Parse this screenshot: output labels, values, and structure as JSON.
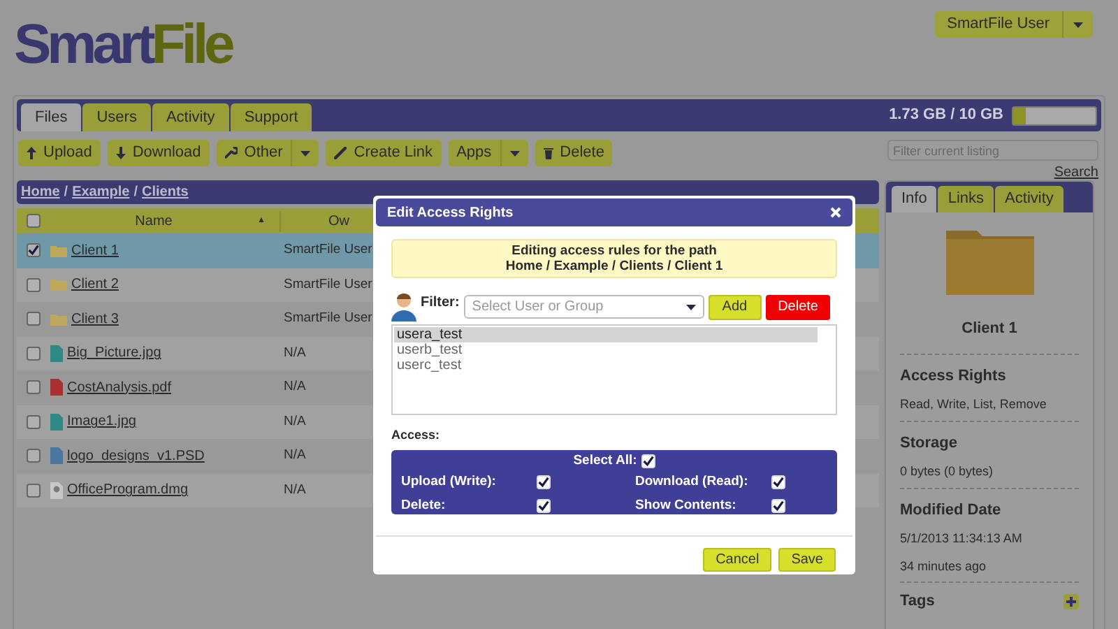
{
  "logo": [
    "Smart",
    "File"
  ],
  "user_menu": {
    "label": "SmartFile User"
  },
  "main_tabs": [
    {
      "label": "Files",
      "selected": true
    },
    {
      "label": "Users",
      "selected": false
    },
    {
      "label": "Activity",
      "selected": false
    },
    {
      "label": "Support",
      "selected": false
    }
  ],
  "storage": {
    "reading": "1.73 GB / 10 GB",
    "level": 0.16
  },
  "toolbar": [
    {
      "label": "Upload",
      "dropdown": false
    },
    {
      "label": "Download",
      "dropdown": false
    },
    {
      "label": "Other",
      "dropdown": true
    },
    {
      "label": "Create Link",
      "dropdown": false
    },
    {
      "label": "Apps",
      "dropdown": true
    },
    {
      "label": "Delete",
      "dropdown": false
    }
  ],
  "filter": {
    "placeholder": "Filter current listing"
  },
  "search_link": "Search",
  "breadcrumb": {
    "items": [
      "Home",
      "Example",
      "Clients"
    ],
    "separator": "/"
  },
  "table": {
    "columns": [
      "Name",
      "Ow"
    ],
    "sort_arrow": "▲",
    "all_checked": false,
    "rows": [
      {
        "name": "Client 1",
        "owner": "SmartFile User",
        "kind": "folder",
        "checked": true,
        "selected": true
      },
      {
        "name": "Client 2",
        "owner": "SmartFile User",
        "kind": "folder",
        "checked": false,
        "selected": false
      },
      {
        "name": "Client 3",
        "owner": "SmartFile User",
        "kind": "folder",
        "checked": false,
        "selected": false
      },
      {
        "name": "Big_Picture.jpg",
        "owner": "N/A",
        "kind": "image",
        "checked": false,
        "selected": false
      },
      {
        "name": "CostAnalysis.pdf",
        "owner": "N/A",
        "kind": "pdf",
        "checked": false,
        "selected": false
      },
      {
        "name": "Image1.jpg",
        "owner": "N/A",
        "kind": "image",
        "checked": false,
        "selected": false
      },
      {
        "name": "logo_designs_v1.PSD",
        "owner": "N/A",
        "kind": "psd",
        "checked": false,
        "selected": false
      },
      {
        "name": "OfficeProgram.dmg",
        "owner": "N/A",
        "kind": "disk",
        "checked": false,
        "selected": false
      }
    ]
  },
  "info_panel": {
    "tabs": [
      {
        "label": "Info",
        "selected": true
      },
      {
        "label": "Links",
        "selected": false
      },
      {
        "label": "Activity",
        "selected": false
      }
    ],
    "title": "Client 1",
    "sections": [
      {
        "heading": "Access Rights",
        "lines": [
          "Read, Write, List, Remove"
        ]
      },
      {
        "heading": "Storage",
        "lines": [
          "0 bytes (0 bytes)"
        ]
      },
      {
        "heading": "Modified Date",
        "lines": [
          "5/1/2013 11:34:13 AM",
          "34 minutes ago"
        ]
      }
    ],
    "tags_heading": "Tags"
  },
  "dialog": {
    "title": "Edit Access Rights",
    "notice": [
      "Editing access rules for the path",
      "Home / Example / Clients / Client 1"
    ],
    "filter_label": "Filter:",
    "select_placeholder": "Select User or Group",
    "add": "Add",
    "delete": "Delete",
    "users": [
      {
        "name": "usera_test",
        "selected": true
      },
      {
        "name": "userb_test",
        "selected": false
      },
      {
        "name": "userc_test",
        "selected": false
      }
    ],
    "access_label": "Access:",
    "select_all": {
      "label": "Select All:",
      "checked": true
    },
    "permissions": [
      {
        "label": "Upload (Write):",
        "checked": true
      },
      {
        "label": "Download (Read):",
        "checked": true
      },
      {
        "label": "Delete:",
        "checked": true
      },
      {
        "label": "Show Contents:",
        "checked": true
      }
    ],
    "cancel": "Cancel",
    "save": "Save"
  }
}
